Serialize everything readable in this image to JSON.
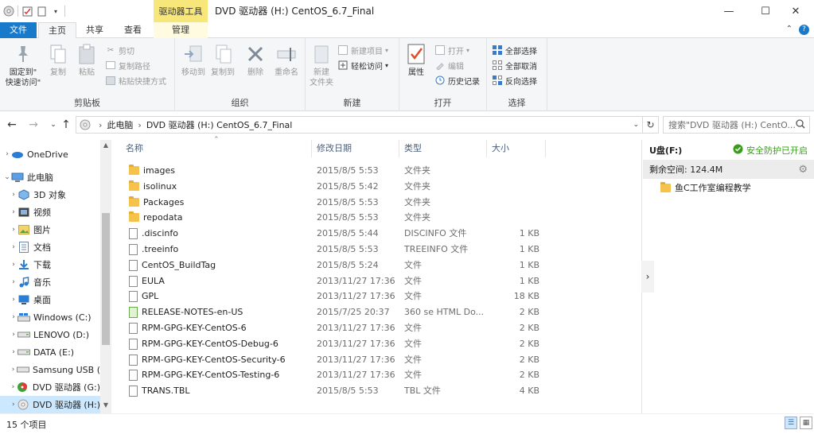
{
  "title_bar": {
    "contextual_tab_title": "驱动器工具",
    "window_title": "DVD 驱动器 (H:) CentOS_6.7_Final",
    "controls": {
      "minimize": "—",
      "maximize": "☐",
      "close": "✕"
    }
  },
  "ribbon_tabs": {
    "file": "文件",
    "home": "主页",
    "share": "共享",
    "view": "查看",
    "manage": "管理",
    "collapse_icon": "chevron-up-icon",
    "help_icon": "help-icon"
  },
  "ribbon": {
    "clipboard": {
      "label": "剪贴板",
      "pin": "固定到\"\n快速访问\"",
      "copy": "复制",
      "paste": "粘贴",
      "cut": "剪切",
      "copy_path": "复制路径",
      "paste_shortcut": "粘贴快捷方式"
    },
    "organize": {
      "label": "组织",
      "move_to": "移动到",
      "copy_to": "复制到",
      "delete": "删除",
      "rename": "重命名"
    },
    "new": {
      "label": "新建",
      "new_folder": "新建\n文件夹",
      "new_item": "新建项目",
      "easy_access": "轻松访问"
    },
    "open": {
      "label": "打开",
      "properties": "属性",
      "open": "打开",
      "edit": "编辑",
      "history": "历史记录"
    },
    "select": {
      "label": "选择",
      "select_all": "全部选择",
      "select_none": "全部取消",
      "invert": "反向选择"
    }
  },
  "address": {
    "back": "←",
    "forward": "→",
    "up": "↑",
    "crumb_pc": "此电脑",
    "sep": "›",
    "crumb_drive": "DVD 驱动器 (H:) CentOS_6.7_Final",
    "search_placeholder": "搜索\"DVD 驱动器 (H:) CentO..."
  },
  "nav_pane": {
    "items": [
      {
        "label": "OneDrive",
        "icon": "cloud-icon"
      },
      {
        "label": "此电脑",
        "icon": "computer-icon"
      },
      {
        "label": "3D 对象",
        "icon": "cube-icon"
      },
      {
        "label": "视频",
        "icon": "video-icon"
      },
      {
        "label": "图片",
        "icon": "picture-icon"
      },
      {
        "label": "文档",
        "icon": "document-icon"
      },
      {
        "label": "下载",
        "icon": "download-icon"
      },
      {
        "label": "音乐",
        "icon": "music-icon"
      },
      {
        "label": "桌面",
        "icon": "desktop-icon"
      },
      {
        "label": "Windows (C:)",
        "icon": "windows-drive-icon"
      },
      {
        "label": "LENOVO (D:)",
        "icon": "drive-icon"
      },
      {
        "label": "DATA (E:)",
        "icon": "drive-icon"
      },
      {
        "label": "Samsung USB (",
        "icon": "usb-drive-icon"
      },
      {
        "label": "DVD 驱动器 (G:)",
        "icon": "dvd-drive-icon"
      },
      {
        "label": "DVD 驱动器 (H:)",
        "icon": "dvd-disc-icon"
      }
    ]
  },
  "file_list": {
    "columns": {
      "name": "名称",
      "date": "修改日期",
      "type": "类型",
      "size": "大小"
    },
    "rows": [
      {
        "name": "images",
        "date": "2015/8/5 5:53",
        "type": "文件夹",
        "size": "",
        "kind": "folder"
      },
      {
        "name": "isolinux",
        "date": "2015/8/5 5:42",
        "type": "文件夹",
        "size": "",
        "kind": "folder"
      },
      {
        "name": "Packages",
        "date": "2015/8/5 5:53",
        "type": "文件夹",
        "size": "",
        "kind": "folder"
      },
      {
        "name": "repodata",
        "date": "2015/8/5 5:53",
        "type": "文件夹",
        "size": "",
        "kind": "folder"
      },
      {
        "name": ".discinfo",
        "date": "2015/8/5 5:44",
        "type": "DISCINFO 文件",
        "size": "1 KB",
        "kind": "file"
      },
      {
        "name": ".treeinfo",
        "date": "2015/8/5 5:53",
        "type": "TREEINFO 文件",
        "size": "1 KB",
        "kind": "file"
      },
      {
        "name": "CentOS_BuildTag",
        "date": "2015/8/5 5:24",
        "type": "文件",
        "size": "1 KB",
        "kind": "file"
      },
      {
        "name": "EULA",
        "date": "2013/11/27 17:36",
        "type": "文件",
        "size": "1 KB",
        "kind": "file"
      },
      {
        "name": "GPL",
        "date": "2013/11/27 17:36",
        "type": "文件",
        "size": "18 KB",
        "kind": "file"
      },
      {
        "name": "RELEASE-NOTES-en-US",
        "date": "2015/7/25 20:37",
        "type": "360 se HTML Do...",
        "size": "2 KB",
        "kind": "html"
      },
      {
        "name": "RPM-GPG-KEY-CentOS-6",
        "date": "2013/11/27 17:36",
        "type": "文件",
        "size": "2 KB",
        "kind": "file"
      },
      {
        "name": "RPM-GPG-KEY-CentOS-Debug-6",
        "date": "2013/11/27 17:36",
        "type": "文件",
        "size": "2 KB",
        "kind": "file"
      },
      {
        "name": "RPM-GPG-KEY-CentOS-Security-6",
        "date": "2013/11/27 17:36",
        "type": "文件",
        "size": "2 KB",
        "kind": "file"
      },
      {
        "name": "RPM-GPG-KEY-CentOS-Testing-6",
        "date": "2013/11/27 17:36",
        "type": "文件",
        "size": "2 KB",
        "kind": "file"
      },
      {
        "name": "TRANS.TBL",
        "date": "2015/8/5 5:53",
        "type": "TBL 文件",
        "size": "4 KB",
        "kind": "file"
      }
    ]
  },
  "preview": {
    "drive": "U盘(F:)",
    "security": "安全防护已开启",
    "free_space": "剩余空间: 124.4M",
    "item": "鱼C工作室编程教学",
    "collapse": "›"
  },
  "status": {
    "count": "15 个项目"
  },
  "colors": {
    "accent": "#1979ca",
    "context_tab": "#f7e67a",
    "selected": "#cce8ff",
    "security_green": "#3b9b1f"
  }
}
